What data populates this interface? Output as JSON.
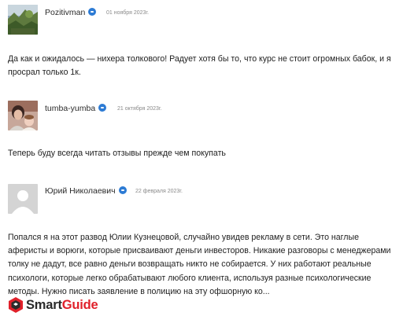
{
  "comments": [
    {
      "author": "Pozitivman",
      "date": "01 ноября 2023г.",
      "avatar": "landscape-photo-avatar",
      "text": "Да как и ожидалось — нихера толкового! Радует хотя бы то, что курс не стоит огромных бабок, и я просрал только 1к."
    },
    {
      "author": "tumba-yumba",
      "date": "21 октября 2023г.",
      "avatar": "people-photo-avatar",
      "text": "Теперь буду всегда читать отзывы прежде чем покупать"
    },
    {
      "author": "Юрий Николаевич",
      "date": "22 февраля 2023г.",
      "avatar": "default-user-avatar",
      "text": "Попался я на этот развод Юлии Кузнецовой, случайно увидев рекламу в сети. Это наглые аферисты и ворюги, которые присваивают деньги инвесторов. Никакие разговоры с менеджерами толку не дадут, все равно деньги возвращать никто не собирается. У них работают реальные психологи, которые легко обрабатывают любого клиента, используя разные психологические методы. Нужно писать заявление в полицию на эту офшорную ко..."
    }
  ],
  "watermark": {
    "smart": "Smart",
    "guide": "Guide",
    "accent_color": "#e0202a"
  },
  "colors": {
    "verified_badge": "#2d7bd4",
    "date_text": "#8a8a8a"
  }
}
